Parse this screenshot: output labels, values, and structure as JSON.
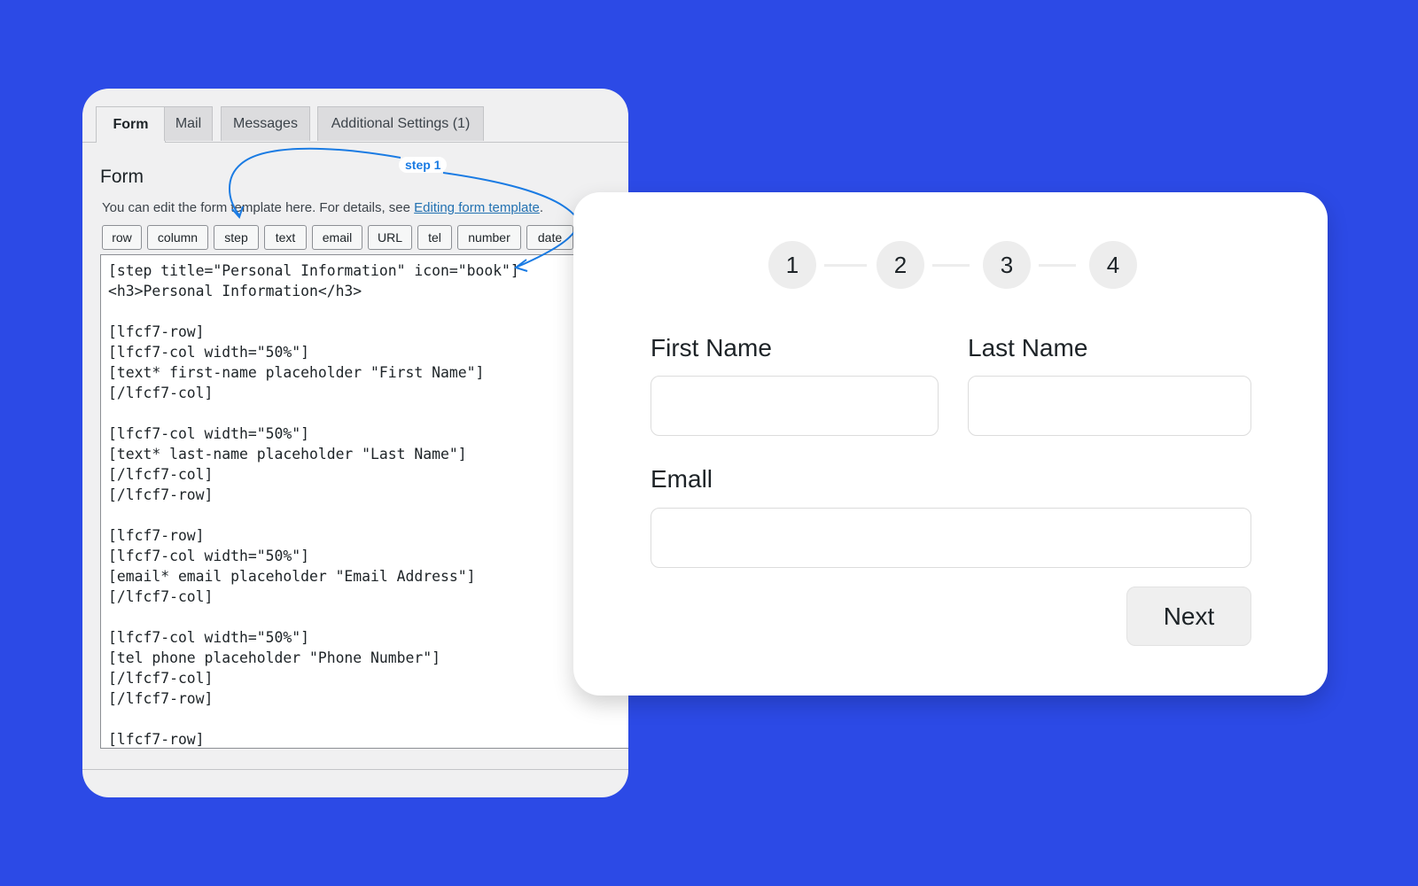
{
  "editor": {
    "tabs": [
      {
        "label": "Form"
      },
      {
        "label": "Mail"
      },
      {
        "label": "Messages"
      },
      {
        "label": "Additional Settings (1)"
      }
    ],
    "heading": "Form",
    "description": "You can edit the form template here. For details, see ",
    "description_link": "Editing form template",
    "description_end": ".",
    "tag_buttons": [
      "row",
      "column",
      "step",
      "text",
      "email",
      "URL",
      "tel",
      "number",
      "date"
    ],
    "code": "[step title=\"Personal Information\" icon=\"book\"]\n<h3>Personal Information</h3>\n\n[lfcf7-row]\n[lfcf7-col width=\"50%\"]\n[text* first-name placeholder \"First Name\"]\n[/lfcf7-col]\n\n[lfcf7-col width=\"50%\"]\n[text* last-name placeholder \"Last Name\"]\n[/lfcf7-col]\n[/lfcf7-row]\n\n[lfcf7-row]\n[lfcf7-col width=\"50%\"]\n[email* email placeholder \"Email Address\"]\n[/lfcf7-col]\n\n[lfcf7-col width=\"50%\"]\n[tel phone placeholder \"Phone Number\"]\n[/lfcf7-col]\n[/lfcf7-row]\n\n[lfcf7-row]"
  },
  "annotation": {
    "label": "step 1",
    "color": "#1a7be3"
  },
  "preview": {
    "steps": [
      "1",
      "2",
      "3",
      "4"
    ],
    "first_name_label": "First Name",
    "last_name_label": "Last Name",
    "email_label": "Emall",
    "first_name_value": "",
    "last_name_value": "",
    "email_value": "",
    "next_label": "Next"
  },
  "colors": {
    "background": "#2c4ae6",
    "link": "#2271b1",
    "card": "#ffffff"
  }
}
